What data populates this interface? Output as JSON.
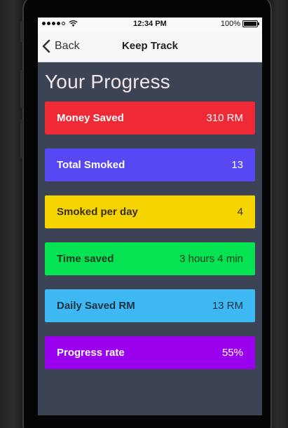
{
  "status_bar": {
    "time": "12:34 PM",
    "battery": "100%"
  },
  "nav": {
    "back_label": "Back",
    "title": "Keep Track"
  },
  "page_title": "Your Progress",
  "cards": [
    {
      "label": "Money Saved",
      "value": "310 RM",
      "bg": "#f02937",
      "fg": "#ffffff"
    },
    {
      "label": "Total Smoked",
      "value": "13",
      "bg": "#5848f3",
      "fg": "#ffffff"
    },
    {
      "label": "Smoked per day",
      "value": "4",
      "bg": "#f5d400",
      "fg": "#3a3000"
    },
    {
      "label": "Time saved",
      "value": "3 hours 4 min",
      "bg": "#05e353",
      "fg": "#1c3a24"
    },
    {
      "label": "Daily Saved RM",
      "value": "13 RM",
      "bg": "#3db8f3",
      "fg": "#1e3240"
    },
    {
      "label": "Progress rate",
      "value": "55%",
      "bg": "#9a00ee",
      "fg": "#ffffff"
    }
  ]
}
